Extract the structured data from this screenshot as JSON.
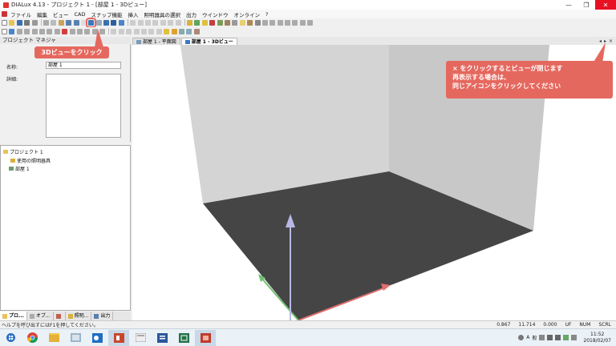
{
  "window": {
    "title": "DIALux 4.13 - プロジェクト 1 - [部屋 1 - 3Dビュー]",
    "minimize_glyph": "—",
    "maximize_glyph": "❐",
    "close_glyph": "✕"
  },
  "menu": {
    "items": [
      "ファイル",
      "編集",
      "ビュー",
      "CAD",
      "スナップ機能",
      "挿入",
      "照明器具の選択",
      "出力",
      "ウインドウ",
      "オンライン",
      "?"
    ]
  },
  "project_manager": {
    "title": "プロジェクト マネジャ",
    "name_label": "名称:",
    "name_value": "部屋 1",
    "detail_label": "詳細:",
    "tree": {
      "root": "プロジェクト 1",
      "child1": "使用の照明器具",
      "child2": "部屋 1"
    },
    "tabs": [
      "プロ...",
      "オブ...",
      "",
      "照明...",
      "出力"
    ]
  },
  "view_tabs": {
    "tab1": "部屋 1 - 平面図",
    "tab2": "部屋 1 - 3Dビュー",
    "nav_left": "◂",
    "nav_right": "▸",
    "close": "×"
  },
  "callouts": {
    "view3d": "3Dビューをクリック",
    "close_line1": "× をクリックするとビューが閉じます",
    "close_line2": "再表示する場合は、",
    "close_line3": "同じアイコンをクリックしてください"
  },
  "statusbar": {
    "help": "ヘルプを呼び出すにはF1を押してください。",
    "x": "0.867",
    "y": "11.714",
    "z": "0.000",
    "uf": "UF",
    "num": "NUM",
    "scrl": "SCRL"
  },
  "taskbar": {
    "apps": [
      "start-icon",
      "chrome-icon",
      "explorer-icon",
      "folder-icon",
      "outlook-icon",
      "powerpoint-icon",
      "generic-icon",
      "word-icon",
      "excel-icon",
      "dialux-icon"
    ],
    "ime": "A",
    "ime2": "般",
    "time": "11:52",
    "date": "2018/02/07"
  },
  "colors": {
    "callout": "#e5685e",
    "floor": "#454545",
    "left_wall": "#d2d2d2",
    "back_wall": "#bdbdbd",
    "right_wall": "#c9c9c9"
  }
}
